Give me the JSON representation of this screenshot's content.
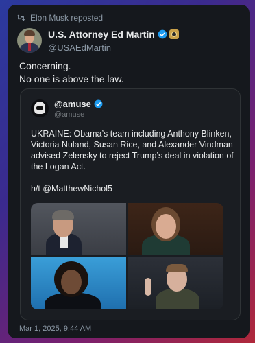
{
  "repost": {
    "label": "Elon Musk reposted"
  },
  "post": {
    "author_name": "U.S. Attorney Ed Martin",
    "author_handle": "@USAEdMartin",
    "text_lines": [
      "Concerning.",
      "No one is above the law."
    ],
    "timestamp": "Mar 1, 2025, 9:44 AM"
  },
  "quote": {
    "author_name": "@amuse",
    "author_handle": "@amuse",
    "text_lines": [
      "UKRAINE: Obama’s team including Anthony Blinken,",
      "Victoria Nuland, Susan Rice, and Alexander Vindman",
      "advised Zelensky to reject Trump’s deal in violation of",
      "the Logan Act."
    ],
    "hat_tip": "h/t @MatthewNichol5"
  },
  "colors": {
    "accent": "#1d9bf0",
    "card_bg": "#15181d",
    "muted": "#8b98a5"
  },
  "icons": [
    "repost-icon",
    "verified-badge-icon",
    "government-seal-icon"
  ]
}
